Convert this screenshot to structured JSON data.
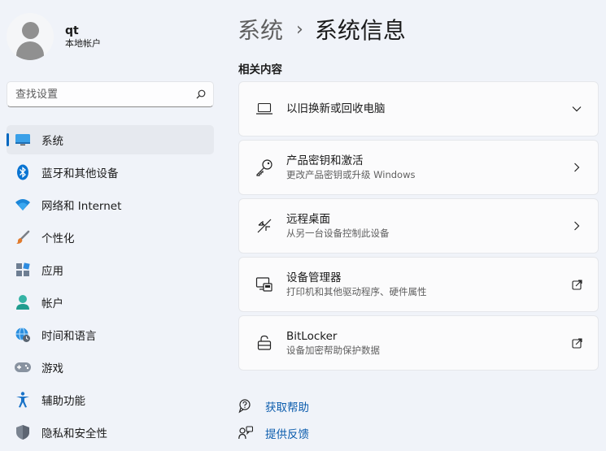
{
  "profile": {
    "name": "qt",
    "account_type": "本地帐户"
  },
  "search": {
    "placeholder": "查找设置"
  },
  "nav": {
    "items": [
      {
        "label": "系统",
        "icon": "monitor-icon"
      },
      {
        "label": "蓝牙和其他设备",
        "icon": "bluetooth-icon"
      },
      {
        "label": "网络和 Internet",
        "icon": "wifi-icon"
      },
      {
        "label": "个性化",
        "icon": "brush-icon"
      },
      {
        "label": "应用",
        "icon": "apps-icon"
      },
      {
        "label": "帐户",
        "icon": "person-icon"
      },
      {
        "label": "时间和语言",
        "icon": "globe-clock-icon"
      },
      {
        "label": "游戏",
        "icon": "gamepad-icon"
      },
      {
        "label": "辅助功能",
        "icon": "accessibility-icon"
      },
      {
        "label": "隐私和安全性",
        "icon": "shield-icon"
      }
    ],
    "active_index": 0
  },
  "breadcrumb": {
    "parent": "系统",
    "separator": "›",
    "current": "系统信息"
  },
  "related": {
    "title": "相关内容",
    "cards": [
      {
        "title": "以旧换新或回收电脑",
        "subtitle": "",
        "icon": "laptop-icon",
        "action": "chevron-down-icon"
      },
      {
        "title": "产品密钥和激活",
        "subtitle": "更改产品密钥或升级 Windows",
        "icon": "key-icon",
        "action": "chevron-right-icon"
      },
      {
        "title": "远程桌面",
        "subtitle": "从另一台设备控制此设备",
        "icon": "remote-desktop-icon",
        "action": "chevron-right-icon"
      },
      {
        "title": "设备管理器",
        "subtitle": "打印机和其他驱动程序、硬件属性",
        "icon": "device-manager-icon",
        "action": "external-link-icon"
      },
      {
        "title": "BitLocker",
        "subtitle": "设备加密帮助保护数据",
        "icon": "lock-icon",
        "action": "external-link-icon"
      }
    ]
  },
  "help": {
    "get_help": "获取帮助",
    "feedback": "提供反馈"
  },
  "colors": {
    "accent": "#0067c0",
    "link": "#0b5cad",
    "background": "#f0f3f9",
    "card": "#fbfbfc"
  }
}
